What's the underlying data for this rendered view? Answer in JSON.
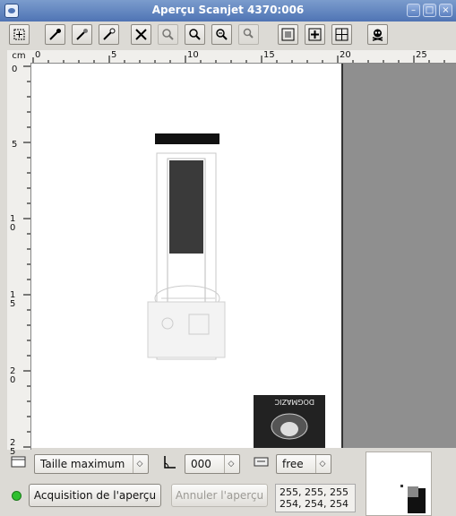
{
  "window": {
    "title": "Aperçu Scanjet 4370:006",
    "buttons": [
      "minimize",
      "maximize",
      "close"
    ]
  },
  "toolbar": {
    "buttons": [
      {
        "name": "select-area-icon",
        "enabled": true
      },
      {
        "name": "eyedropper-black-icon",
        "enabled": true
      },
      {
        "name": "eyedropper-gray-icon",
        "enabled": true
      },
      {
        "name": "eyedropper-white-icon",
        "enabled": true
      },
      {
        "name": "reset-selection-icon",
        "enabled": true
      },
      {
        "name": "zoom-in-icon",
        "enabled": false
      },
      {
        "name": "zoom-area-icon",
        "enabled": true
      },
      {
        "name": "zoom-out-icon",
        "enabled": true
      },
      {
        "name": "zoom-undo-icon",
        "enabled": false
      },
      {
        "name": "autoselect-icon",
        "enabled": true
      },
      {
        "name": "fit-selection-icon",
        "enabled": true
      },
      {
        "name": "full-area-icon",
        "enabled": true
      },
      {
        "name": "delete-preview-icon",
        "enabled": true
      }
    ]
  },
  "ruler": {
    "unit": "cm",
    "horizontal_labels": [
      "0",
      "5",
      "10",
      "15",
      "20",
      "25"
    ],
    "vertical_labels": [
      "0",
      "5",
      "10",
      "15",
      "20",
      "25"
    ]
  },
  "controls": {
    "size_option": "Taille maximum",
    "orientation_value": "000",
    "ratio_option": "free",
    "acquire_button": "Acquisition de l'aperçu",
    "cancel_button": "Annuler l'aperçu",
    "pixel_values": [
      "255, 255, 255",
      "254, 254, 254"
    ],
    "status_color": "#2fbf2f"
  }
}
